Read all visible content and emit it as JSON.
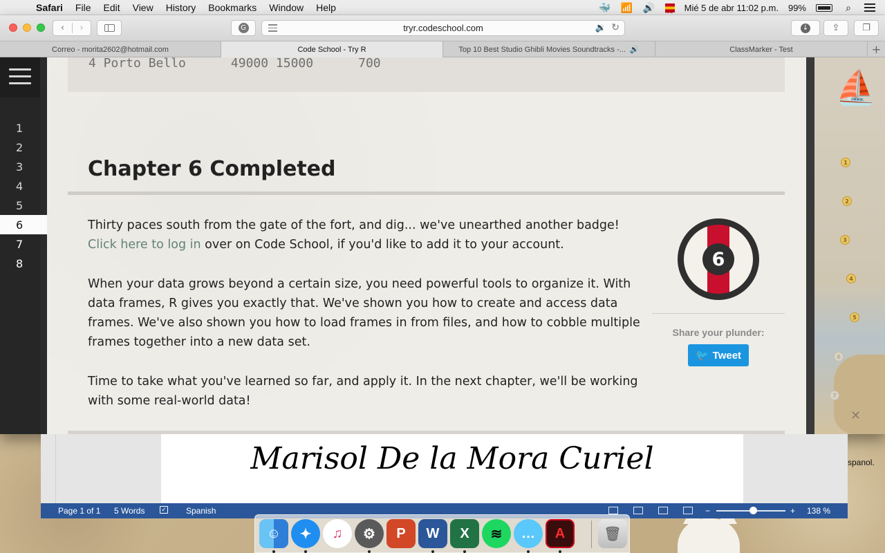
{
  "menubar": {
    "app_name": "Safari",
    "items": [
      "File",
      "Edit",
      "View",
      "History",
      "Bookmarks",
      "Window",
      "Help"
    ],
    "clock": "Mié 5 de abr  11:02 p.m.",
    "battery": "99%",
    "flag_text": "ISO"
  },
  "toolbar": {
    "url": "tryr.codeschool.com"
  },
  "tabs": [
    {
      "label": "Correo - morita2602@hotmail.com"
    },
    {
      "label": "Code School - Try R"
    },
    {
      "label": "Top 10 Best Studio Ghibli Movies Soundtracks -..."
    },
    {
      "label": "ClassMarker - Test"
    }
  ],
  "sidebar": {
    "chapters": [
      "1",
      "2",
      "3",
      "4",
      "5",
      "6",
      "7",
      "8"
    ],
    "current_chapter": "6"
  },
  "content": {
    "code_line": "4 Porto Bello      49000 15000      700",
    "title": "Chapter 6 Completed",
    "p1_text": "Thirty paces south from the gate of the fort, and dig... we've unearthed another badge!",
    "p1_link": "Click here to log in",
    "p1_rest": " over on Code School, if you'd like to add it to your account.",
    "p2": "When your data grows beyond a certain size, you need powerful tools to organize it. With data frames, R gives you exactly that. We've shown you how to create and access data frames. We've also shown you how to load frames in from files, and how to cobble multiple frames together into a new data set.",
    "p3": "Time to take what you've learned so far, and apply it. In the next chapter, we'll be working with some real-world data!",
    "badge_number": "6",
    "share_label": "Share your plunder:",
    "tweet_label": "Tweet"
  },
  "map": {
    "dots": [
      "1",
      "2",
      "3",
      "4",
      "5",
      "6",
      "7"
    ]
  },
  "word": {
    "doc_text": "Marisol De la Mora Curiel",
    "page_info": "Page 1 of 1",
    "words": "5 Words",
    "language": "Spanish",
    "zoom": "138 %",
    "zoom_minus": "−",
    "zoom_plus": "+"
  },
  "desktop": {
    "side_text": "spanol."
  },
  "dock": {
    "apps": [
      "Finder",
      "Safari",
      "iTunes",
      "System Preferences",
      "PowerPoint",
      "Word",
      "Excel",
      "Spotify",
      "Messages",
      "Acrobat",
      "Trash"
    ]
  },
  "colors": {
    "tweet_blue": "#1b95e0",
    "badge_red": "#c8102e",
    "word_blue": "#2b579a",
    "link_green": "#62827b"
  }
}
